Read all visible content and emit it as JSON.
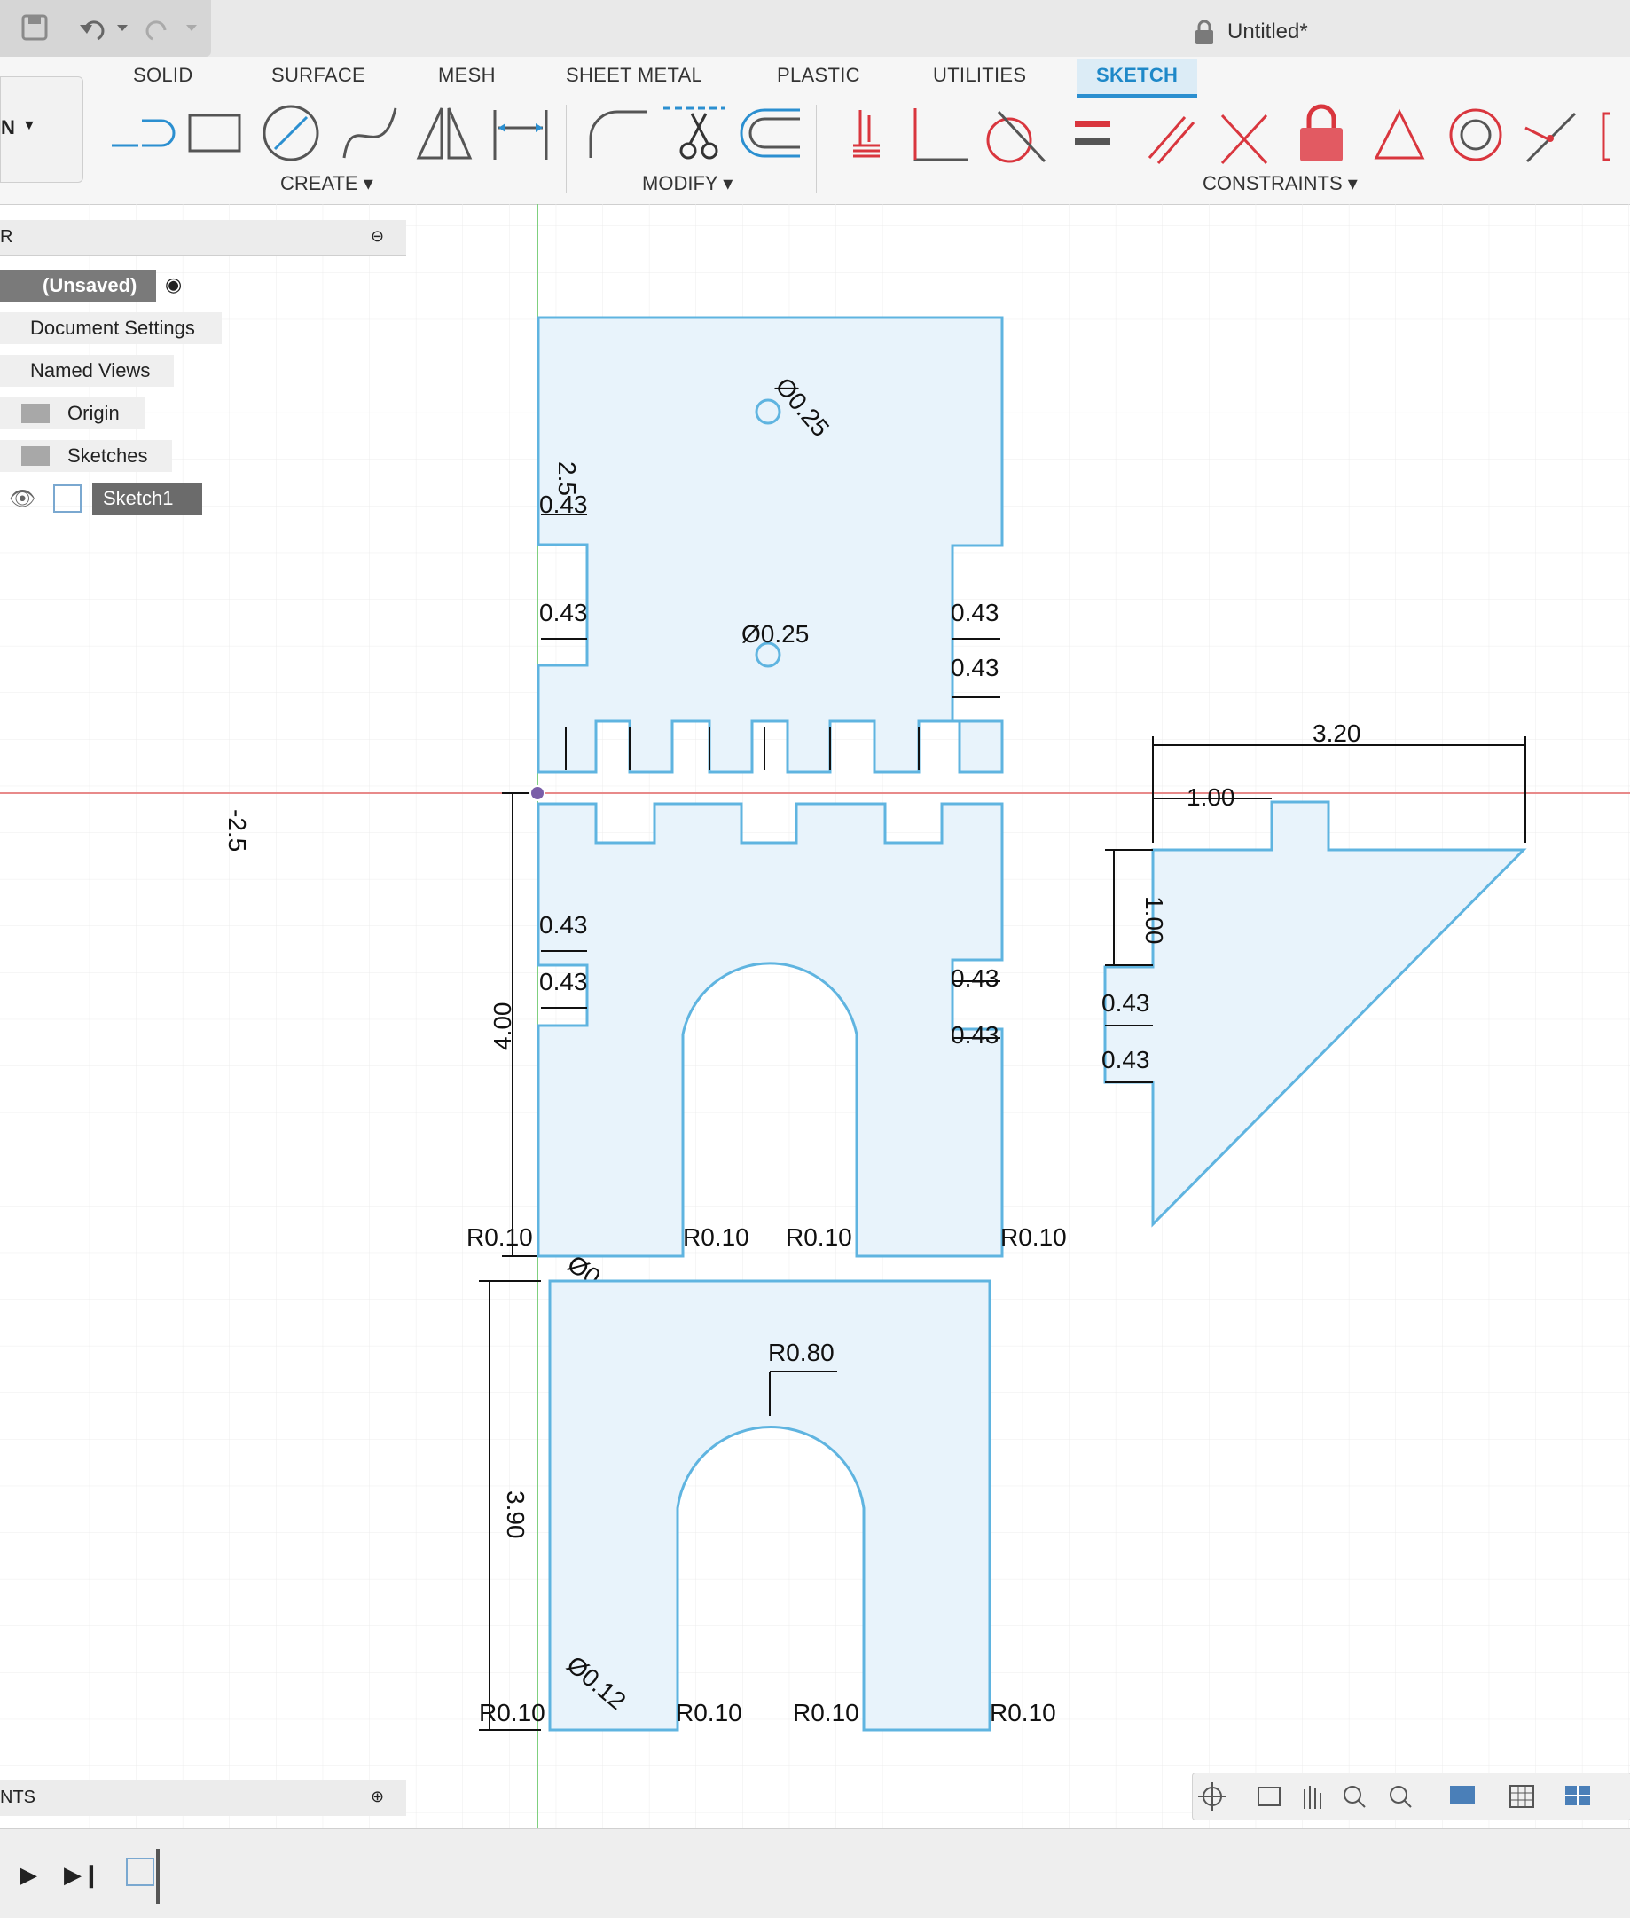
{
  "window": {
    "title": "Untitled*"
  },
  "workspace_selector": {
    "label": "N"
  },
  "tabs": [
    {
      "label": "SOLID"
    },
    {
      "label": "SURFACE"
    },
    {
      "label": "MESH"
    },
    {
      "label": "SHEET METAL"
    },
    {
      "label": "PLASTIC"
    },
    {
      "label": "UTILITIES"
    },
    {
      "label": "SKETCH",
      "active": true
    }
  ],
  "toolbar_groups": {
    "create": "CREATE ▾",
    "modify": "MODIFY ▾",
    "constraints": "CONSTRAINTS ▾"
  },
  "browser": {
    "header": "R",
    "nodes": [
      {
        "label": "(Unsaved)"
      },
      {
        "label": "Document Settings"
      },
      {
        "label": "Named Views"
      },
      {
        "label": "Origin"
      },
      {
        "label": "Sketches"
      },
      {
        "label": "Sketch1"
      }
    ]
  },
  "comments": {
    "label": "NTS"
  },
  "sketch_dimensions": {
    "top_part": {
      "hole_dia_1": "Ø0.25",
      "hole_dia_2": "Ø0.25",
      "offset": "2.5",
      "slot": "0.43"
    },
    "middle_part": {
      "height": "4.00",
      "slot": "0.43",
      "fillet": "R0.10",
      "hole": "Ø0.12"
    },
    "bottom_part": {
      "height": "3.90",
      "arch_radius": "R0.80",
      "fillet": "R0.10",
      "hole": "Ø0.12"
    },
    "right_part": {
      "width": "3.20",
      "offset": "1.00",
      "height": "1.00",
      "slot": "0.43"
    },
    "axis_label": "-2.5"
  },
  "colors": {
    "sketch_line": "#5fb4e0",
    "sketch_fill": "#e8f3fb",
    "grid": "#e6e6e6",
    "x_axis": "#e88a8a",
    "y_axis": "#7fd07f",
    "active_tab": "#2b8fd0",
    "constraint_red": "#d9363e"
  },
  "icons": [
    "save-icon",
    "undo-icon",
    "redo-icon",
    "lock-icon",
    "line-icon",
    "rectangle-icon",
    "circle-icon",
    "spline-icon",
    "mirror-icon",
    "dimension-icon",
    "fillet-icon",
    "trim-icon",
    "offset-icon",
    "coincident-icon",
    "fix-icon",
    "tangent-icon",
    "equal-icon",
    "parallel-icon",
    "perpendicular-icon",
    "lock-constraint-icon",
    "triangle-icon",
    "concentric-icon",
    "midpoint-icon",
    "eye-icon",
    "sketch-icon",
    "play-icon",
    "step-icon"
  ]
}
